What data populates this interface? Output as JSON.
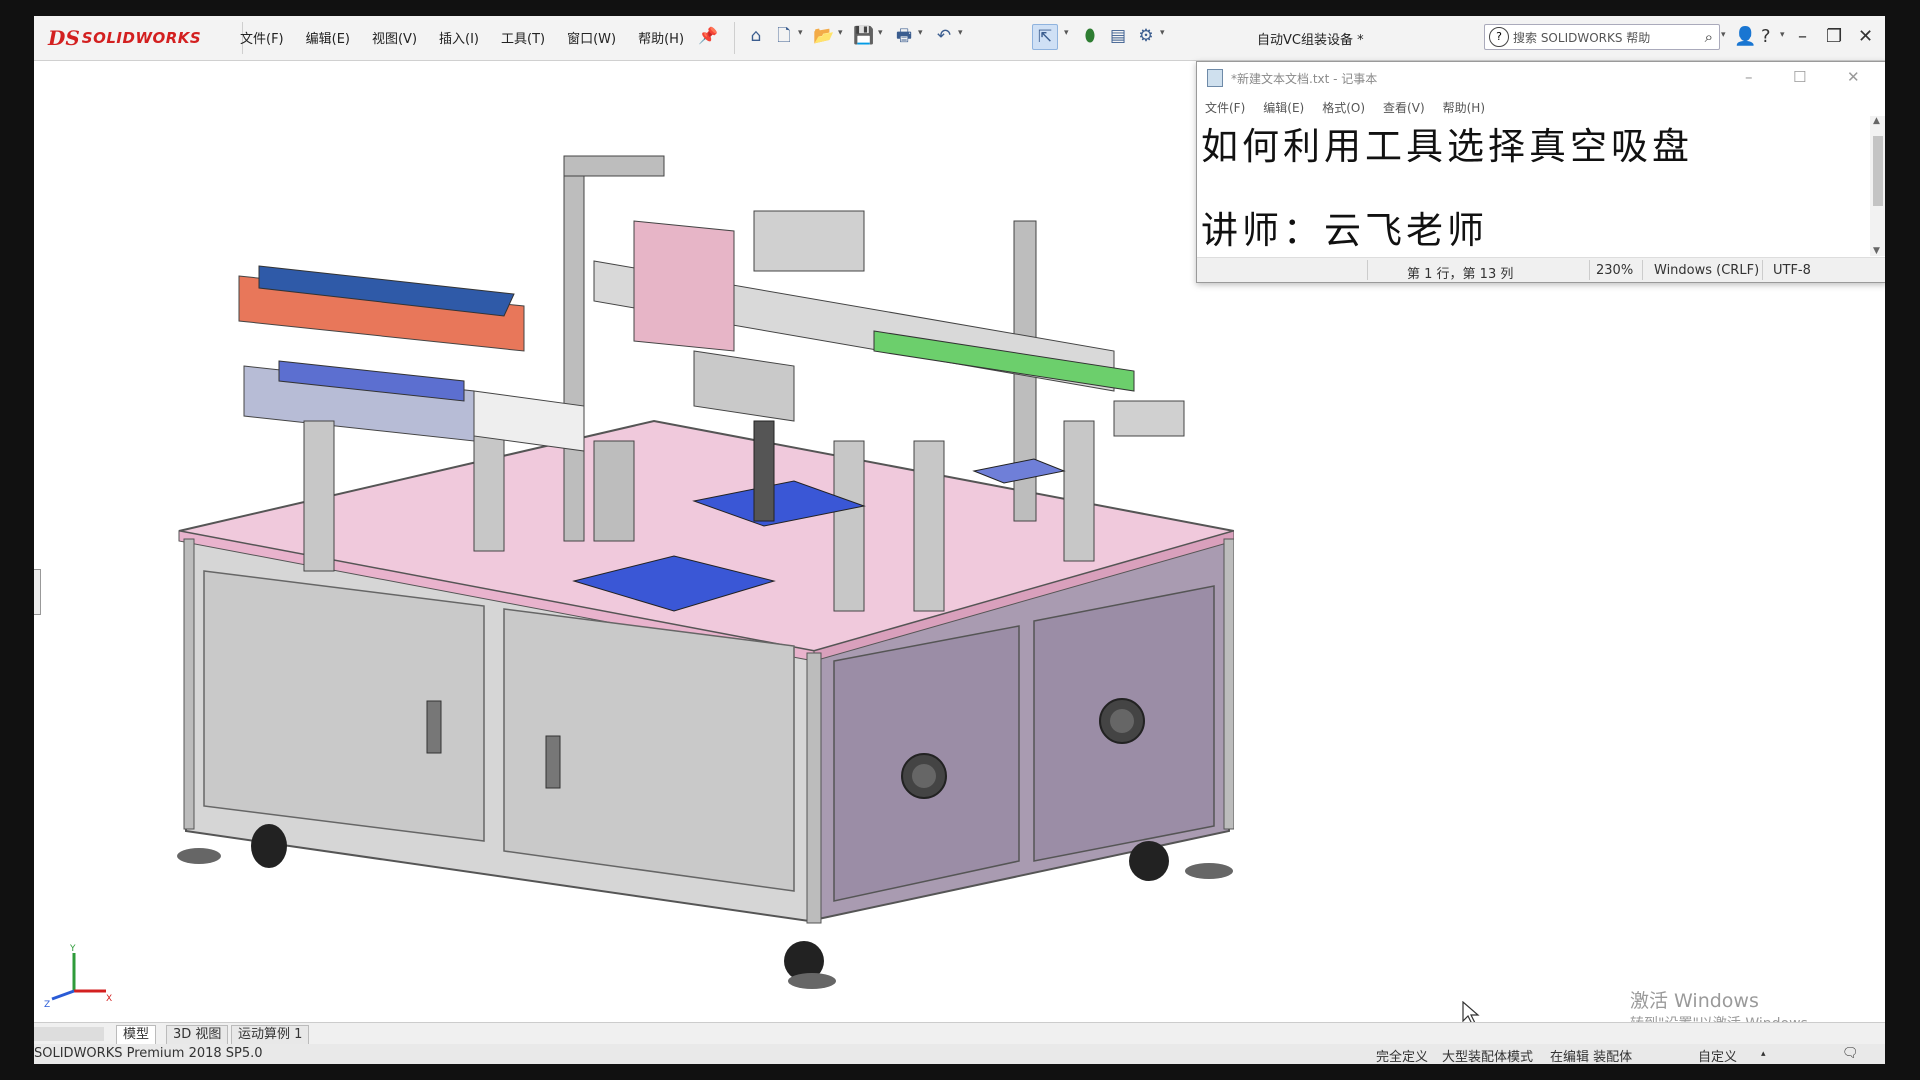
{
  "app": {
    "logo_ds": "DS",
    "logo_text": "SOLIDWORKS",
    "menu": [
      "文件(F)",
      "编辑(E)",
      "视图(V)",
      "插入(I)",
      "工具(T)",
      "窗口(W)",
      "帮助(H)"
    ],
    "document_title": "自动VC组装设备 *",
    "search_placeholder": "搜索 SOLIDWORKS 帮助",
    "accent_color": "#d32020"
  },
  "notepad": {
    "title": "*新建文本文档.txt - 记事本",
    "menu": [
      "文件(F)",
      "编辑(E)",
      "格式(O)",
      "查看(V)",
      "帮助(H)"
    ],
    "lines": [
      "如何利用工具选择真空吸盘",
      "讲师：云飞老师"
    ],
    "status": {
      "position": "第 1 行，第 13 列",
      "zoom": "230%",
      "line_ending": "Windows (CRLF)",
      "encoding": "UTF-8"
    }
  },
  "tabs": [
    "模型",
    "3D 视图",
    "运动算例 1"
  ],
  "status_bar": {
    "product": "SOLIDWORKS Premium 2018 SP5.0",
    "items": [
      "完全定义",
      "大型装配体模式",
      "在编辑 装配体"
    ],
    "custom": "自定义"
  },
  "watermark": {
    "line1": "激活 Windows",
    "line2": "转到\"设置\"以激活 Windows。"
  },
  "icons": [
    "home-icon",
    "new-doc-icon",
    "open-icon",
    "save-icon",
    "print-icon",
    "undo-icon",
    "select-icon",
    "traffic-light-icon",
    "file-props-icon",
    "gear-icon",
    "user-icon",
    "help-icon",
    "minimize-icon",
    "maximize-icon",
    "close-icon"
  ]
}
